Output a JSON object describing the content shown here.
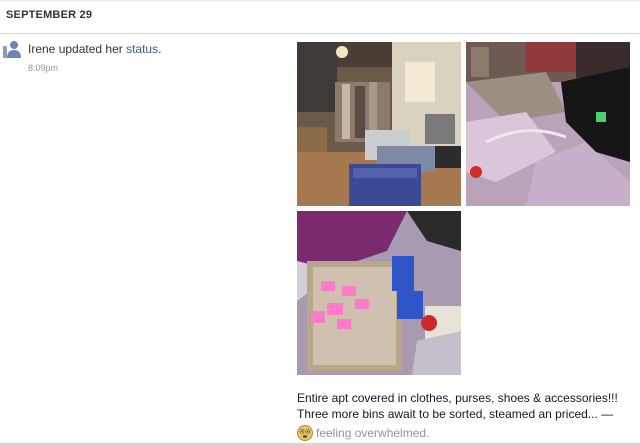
{
  "date_header": "SEPTEMBER 29",
  "story": {
    "actor": "Irene",
    "action": " updated her ",
    "link_text": "status",
    "end": ".",
    "timestamp": "8:09pm",
    "icon": "person-icon"
  },
  "photos": [
    {
      "name": "photo-apartment-bins"
    },
    {
      "name": "photo-clothes-on-bed"
    },
    {
      "name": "photo-sorting-basket"
    }
  ],
  "caption": {
    "line1": "Entire apt covered in clothes, purses, shoes & accessories!!!",
    "line2": "Three more bins await to be sorted, steamed an priced... —",
    "feeling": "feeling overwhelmed.",
    "feeling_icon": "overwhelmed-face-icon"
  }
}
